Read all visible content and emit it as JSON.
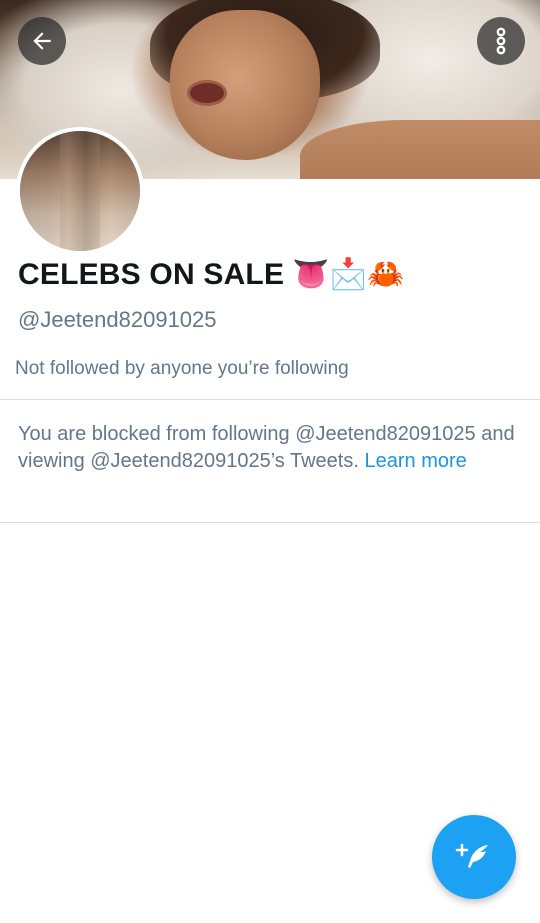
{
  "header": {
    "back_icon": "arrow-left-icon",
    "more_icon": "vertical-dots-icon"
  },
  "profile": {
    "display_name": "CELEBS ON SALE",
    "name_emojis": "👅📩🦀",
    "handle": "@Jeetend82091025",
    "followed_by_text": "Not followed by anyone you’re following"
  },
  "blocked_notice": {
    "text": "You are blocked from following @Jeetend82091025 and viewing @Jeetend82091025’s Tweets.",
    "link_label": "Learn more"
  },
  "fab": {
    "icon": "compose-tweet-icon"
  },
  "colors": {
    "accent": "#1da1f2",
    "link": "#1b95e0",
    "secondary_text": "#657786",
    "divider": "#d7dde2"
  }
}
